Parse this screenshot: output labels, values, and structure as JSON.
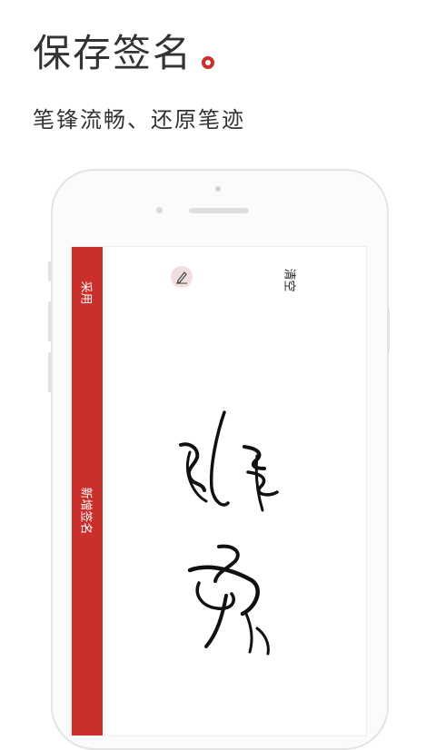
{
  "hero": {
    "title": "保存签名",
    "subtitle": "笔锋流畅、还原笔迹"
  },
  "app": {
    "sidebar": {
      "adopt_label": "采用",
      "new_signature_label": "新增签名"
    },
    "toolbar": {
      "clear_label": "清空"
    },
    "icons": {
      "edit": "pen-edit-icon",
      "accent_dot": "ring-dot-icon"
    }
  },
  "colors": {
    "accent": "#c9302c",
    "text": "#333333",
    "phone_frame": "#e4e4e6"
  }
}
